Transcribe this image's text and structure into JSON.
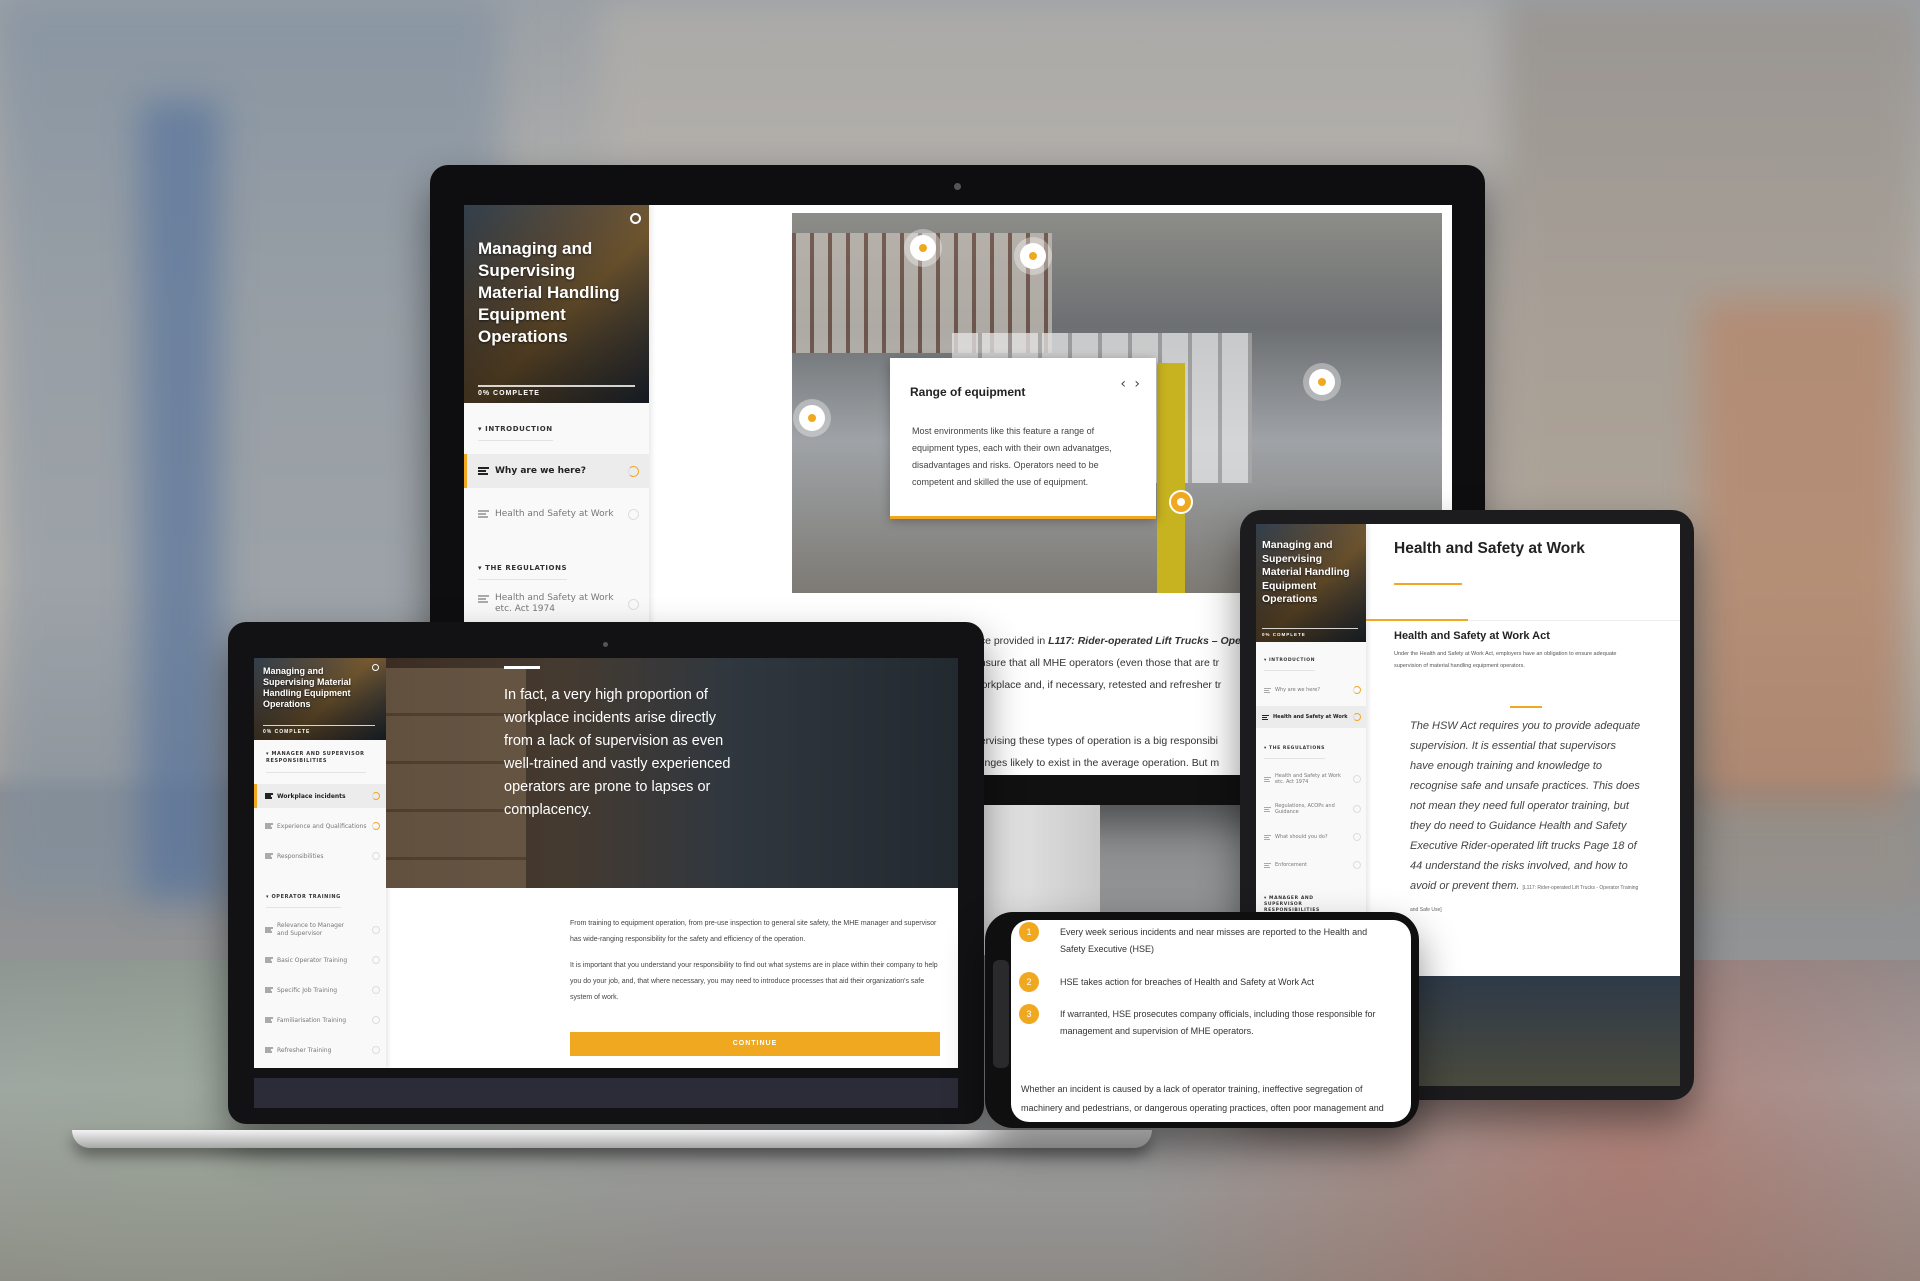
{
  "course": {
    "title": "Managing and Supervising Material Handling Equipment Operations",
    "progress_label": "0% COMPLETE",
    "accent_color": "#f0a820"
  },
  "desktop": {
    "sidebar": {
      "sections": [
        {
          "label": "INTRODUCTION",
          "items": [
            {
              "label": "Why are we here?",
              "active": true,
              "status": "in-progress"
            },
            {
              "label": "Health and Safety at Work",
              "active": false,
              "status": "not-started"
            }
          ]
        },
        {
          "label": "THE REGULATIONS",
          "items": [
            {
              "label": "Health and Safety at Work etc. Act 1974",
              "active": false,
              "status": "not-started"
            }
          ]
        }
      ]
    },
    "hotspot_card": {
      "title": "Range of equipment",
      "body": "Most environments like this feature a range of equipment types, each with their own advanatges, disadvantages and risks. Operators need to be competent and skilled the use of equipment.",
      "prev_icon": "‹",
      "next_icon": "›"
    },
    "body_lines": [
      "nce provided in L117: Rider-operated Lift Trucks – Oper",
      "ensure that all MHE operators (even those that are tr",
      "workplace and, if necessary, retested and refresher tr",
      "pervising these types of operation is a big responsibi",
      "llenges likely to exist in the average operation. But m"
    ],
    "body_italic": "L117: Rider-operated Lift Trucks – Oper"
  },
  "laptop": {
    "sidebar": {
      "sections": [
        {
          "label": "MANAGER AND SUPERVISOR RESPONSIBILITIES",
          "items": [
            {
              "label": "Workplace incidents",
              "active": true,
              "status": "in-progress"
            },
            {
              "label": "Experience and Qualifications",
              "active": false,
              "status": "in-progress"
            },
            {
              "label": "Responsibilities",
              "active": false,
              "status": "not-started"
            }
          ]
        },
        {
          "label": "OPERATOR TRAINING",
          "items": [
            {
              "label": "Relevance to Manager and Supervisor",
              "active": false,
              "status": "not-started"
            },
            {
              "label": "Basic Operator Training",
              "active": false,
              "status": "not-started"
            },
            {
              "label": "Specific Job Training",
              "active": false,
              "status": "not-started"
            },
            {
              "label": "Familiarisation Training",
              "active": false,
              "status": "not-started"
            },
            {
              "label": "Refresher Training",
              "active": false,
              "status": "not-started"
            }
          ]
        }
      ]
    },
    "hero_quote": "In fact, a very high proportion of workplace incidents arise directly from a lack of supervision as even well-trained and vastly experienced operators are prone to lapses or complacency.",
    "paragraphs": [
      "From training to equipment operation, from pre-use inspection to general site safety, the MHE manager and supervisor has wide-ranging responsibility for the safety and efficiency of the operation.",
      "It is important that you understand your responsibility to find out what systems are in place within their company to help you do your job, and, that where necessary, you may need to introduce processes that aid their organization's safe system of work."
    ],
    "continue_label": "CONTINUE"
  },
  "tablet": {
    "sidebar": {
      "sections": [
        {
          "label": "INTRODUCTION",
          "items": [
            {
              "label": "Why are we here?",
              "active": false,
              "status": "in-progress"
            },
            {
              "label": "Health and Safety at Work",
              "active": true,
              "status": "in-progress"
            }
          ]
        },
        {
          "label": "THE REGULATIONS",
          "items": [
            {
              "label": "Health and Safety at Work etc. Act 1974",
              "active": false,
              "status": "not-started"
            },
            {
              "label": "Regulations, ACOPs and Guidance",
              "active": false,
              "status": "not-started"
            },
            {
              "label": "What should you do?",
              "active": false,
              "status": "not-started"
            },
            {
              "label": "Enforcement",
              "active": false,
              "status": "not-started"
            }
          ]
        },
        {
          "label": "MANAGER AND SUPERVISOR RESPONSIBILITIES",
          "items": []
        }
      ]
    },
    "page_title": "Health and Safety at Work",
    "section_title": "Health and Safety at Work Act",
    "section_intro": "Under the Health and Safety at Work Act, employers have an obligation to ensure adequate supervision of material handling equipment operators.",
    "quote": "The HSW Act requires you to provide adequate supervision. It is essential that supervisors have enough training and knowledge to recognise safe and unsafe practices. This does not mean they need full operator training, but they do need to Guidance Health and Safety Executive Rider-operated lift trucks Page 18 of 44 understand the risks involved, and how to avoid or prevent them.",
    "quote_citation": "[L117: Rider-operated Lift Trucks - Operator Training and Safe Use]"
  },
  "phone": {
    "steps": [
      {
        "num": "1",
        "text": "Every week serious incidents and near misses are reported to the Health and Safety Executive (HSE)"
      },
      {
        "num": "2",
        "text": "HSE takes action for breaches of Health and Safety at Work Act"
      },
      {
        "num": "3",
        "text": "If warranted, HSE prosecutes company officials, including those responsible for management and supervision of MHE operators."
      }
    ],
    "paragraph": "Whether an incident is caused by a lack of operator training, ineffective segregation of machinery and pedestrians, or dangerous operating practices, often poor management and"
  }
}
